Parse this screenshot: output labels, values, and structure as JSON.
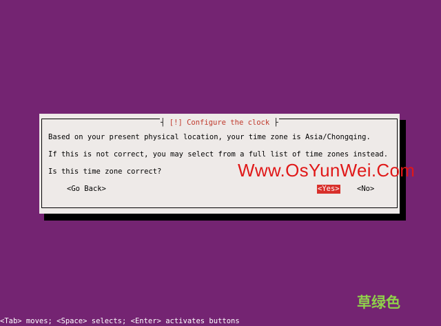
{
  "dialog": {
    "title_open": "[!]",
    "title_text": "Configure the clock",
    "message_line1": "Based on your present physical location, your time zone is Asia/Chongqing.",
    "message_line2": "If this is not correct, you may select from a full list of time zones instead.",
    "question": "Is this time zone correct?",
    "buttons": {
      "go_back": "<Go Back>",
      "yes": "<Yes>",
      "no": "<No>"
    }
  },
  "footer": {
    "help": "<Tab> moves; <Space> selects; <Enter> activates buttons"
  },
  "watermark": {
    "site": "Www.OsYunWei.Com",
    "corner": "草绿色"
  },
  "colors": {
    "background": "#742472",
    "dialog": "#eeeae8",
    "title": "#c0392b",
    "selected_button": "#d8302b",
    "watermark_site": "#e01818",
    "watermark_corner": "#8fd14a"
  }
}
